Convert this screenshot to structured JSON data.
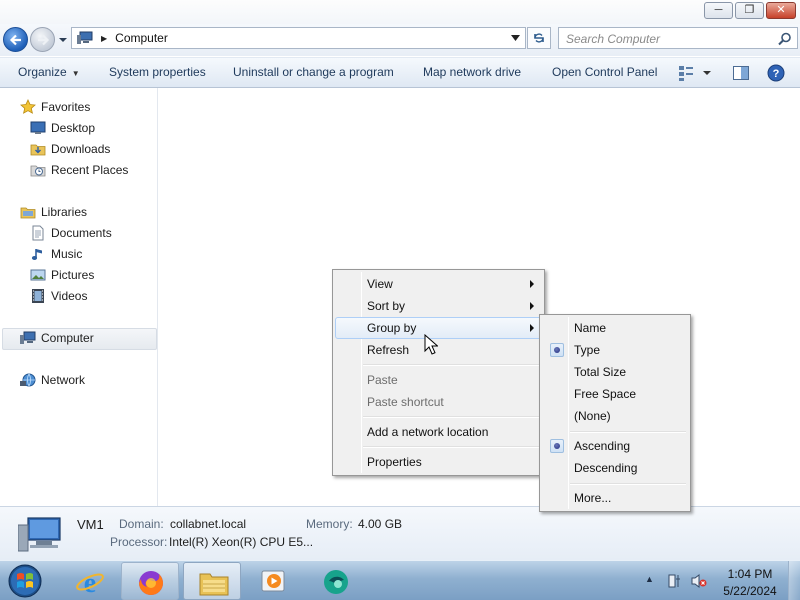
{
  "window": {
    "minimize_glyph": "─",
    "maximize_glyph": "❐",
    "close_glyph": "✕"
  },
  "address": {
    "location": "Computer"
  },
  "search": {
    "placeholder": "Search Computer"
  },
  "toolbar": {
    "organize": "Organize",
    "system_properties": "System properties",
    "uninstall": "Uninstall or change a program",
    "map_drive": "Map network drive",
    "control_panel": "Open Control Panel"
  },
  "nav": {
    "favorites": "Favorites",
    "desktop": "Desktop",
    "downloads": "Downloads",
    "recent": "Recent Places",
    "libraries": "Libraries",
    "documents": "Documents",
    "music": "Music",
    "pictures": "Pictures",
    "videos": "Videos",
    "computer": "Computer",
    "network": "Network"
  },
  "details": {
    "name": "VM1",
    "domain_label": "Domain:",
    "domain_value": "collabnet.local",
    "memory_label": "Memory:",
    "memory_value": "4.00 GB",
    "processor_label": "Processor:",
    "processor_value": "Intel(R) Xeon(R) CPU E5..."
  },
  "context_menu": {
    "view": "View",
    "sort_by": "Sort by",
    "group_by": "Group by",
    "refresh": "Refresh",
    "paste": "Paste",
    "paste_shortcut": "Paste shortcut",
    "add_network_location": "Add a network location",
    "properties": "Properties"
  },
  "group_by_menu": {
    "name": "Name",
    "type": "Type",
    "total_size": "Total Size",
    "free_space": "Free Space",
    "none": "(None)",
    "ascending": "Ascending",
    "descending": "Descending",
    "more": "More...",
    "selected_group": "Type",
    "selected_order": "Ascending"
  },
  "taskbar": {
    "time": "1:04 PM",
    "date": "5/22/2024",
    "tray_expand": "▲",
    "pinned_icons": [
      "internet-explorer-icon",
      "firefox-icon",
      "windows-explorer-icon",
      "media-player-icon",
      "app-icon"
    ]
  },
  "colors": {
    "accent": "#1e395b",
    "menu_highlight": "#aecff7",
    "taskbar": "#8fb0d0"
  }
}
